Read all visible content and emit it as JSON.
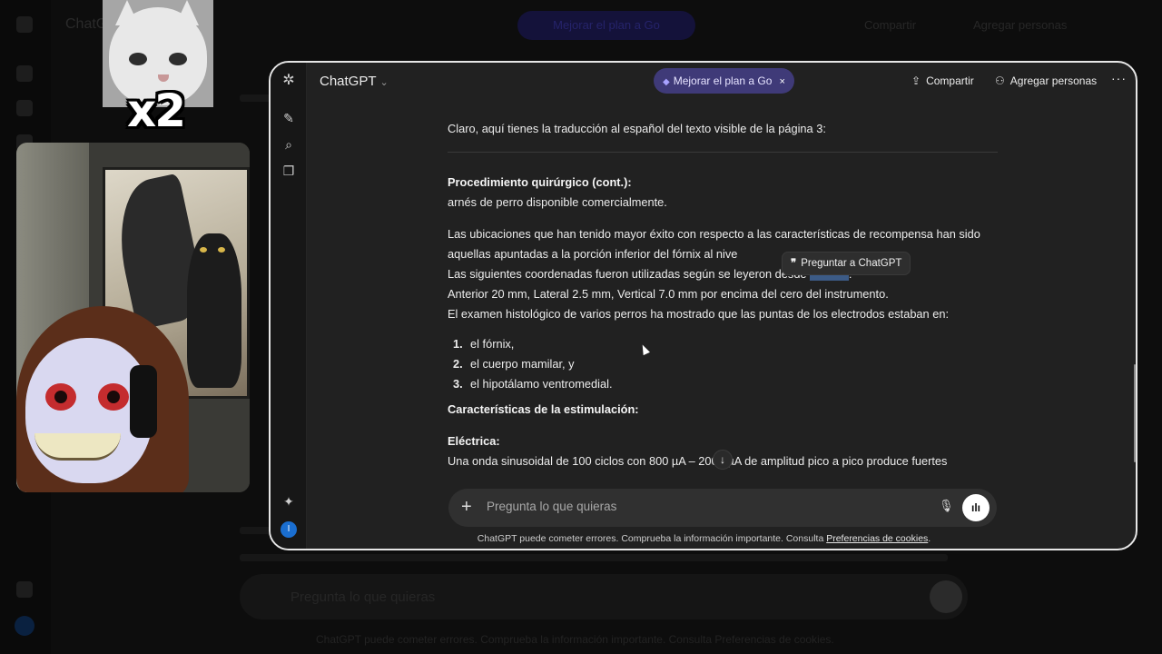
{
  "app": {
    "title": "ChatGPT",
    "upgrade_label": "Mejorar el plan a Go",
    "upgrade_close": "×",
    "share_label": "Compartir",
    "people_label": "Agregar personas",
    "more_label": "···",
    "avatar_initial": "I"
  },
  "sticker": {
    "caption": "x2"
  },
  "message": {
    "intro": "Claro, aquí tienes la traducción al español del texto visible de la página 3:",
    "heading": "Procedimiento quirúrgico (cont.):",
    "line1": "arnés de perro disponible comercialmente.",
    "para2_a": "Las ubicaciones que han tenido mayor éxito con respecto a las características de recompensa han sido aquellas apuntadas a la porción inferior del fórnix al nive",
    "para2_b": "Las siguientes coordenadas fueron utilizadas según se leyeron desde",
    "selected_word": "______",
    "para2_colon": ":",
    "para2_c": "Anterior 20 mm, Lateral 2.5 mm, Vertical 7.0 mm por encima del cero del instrumento.",
    "para2_d": "El examen histológico de varios perros ha mostrado que las puntas de los electrodos estaban en:",
    "list": [
      {
        "num": "1.",
        "text": "el fórnix,"
      },
      {
        "num": "2.",
        "text": "el cuerpo mamilar, y"
      },
      {
        "num": "3.",
        "text": "el hipotálamo ventromedial."
      }
    ],
    "heading2": "Características de la estimulación:",
    "heading3": "Eléctrica:",
    "para3": "Una onda sinusoidal de 100 ciclos con 800 µA – 2000 µA de amplitud pico a pico produce fuertes"
  },
  "tooltip": {
    "quote": "❞",
    "label": "Preguntar a ChatGPT"
  },
  "composer": {
    "placeholder": "Pregunta lo que quieras"
  },
  "footer": {
    "text": "ChatGPT puede cometer errores. Comprueba la información importante. Consulta ",
    "link": "Preferencias de cookies",
    "end": "."
  },
  "background": {
    "title": "ChatGPT",
    "upgrade": "Mejorar el plan a Go",
    "share": "Compartir",
    "people": "Agregar personas",
    "input": "Pregunta lo que quieras",
    "footer": "ChatGPT puede cometer errores. Comprueba la información importante. Consulta Preferencias de cookies."
  }
}
